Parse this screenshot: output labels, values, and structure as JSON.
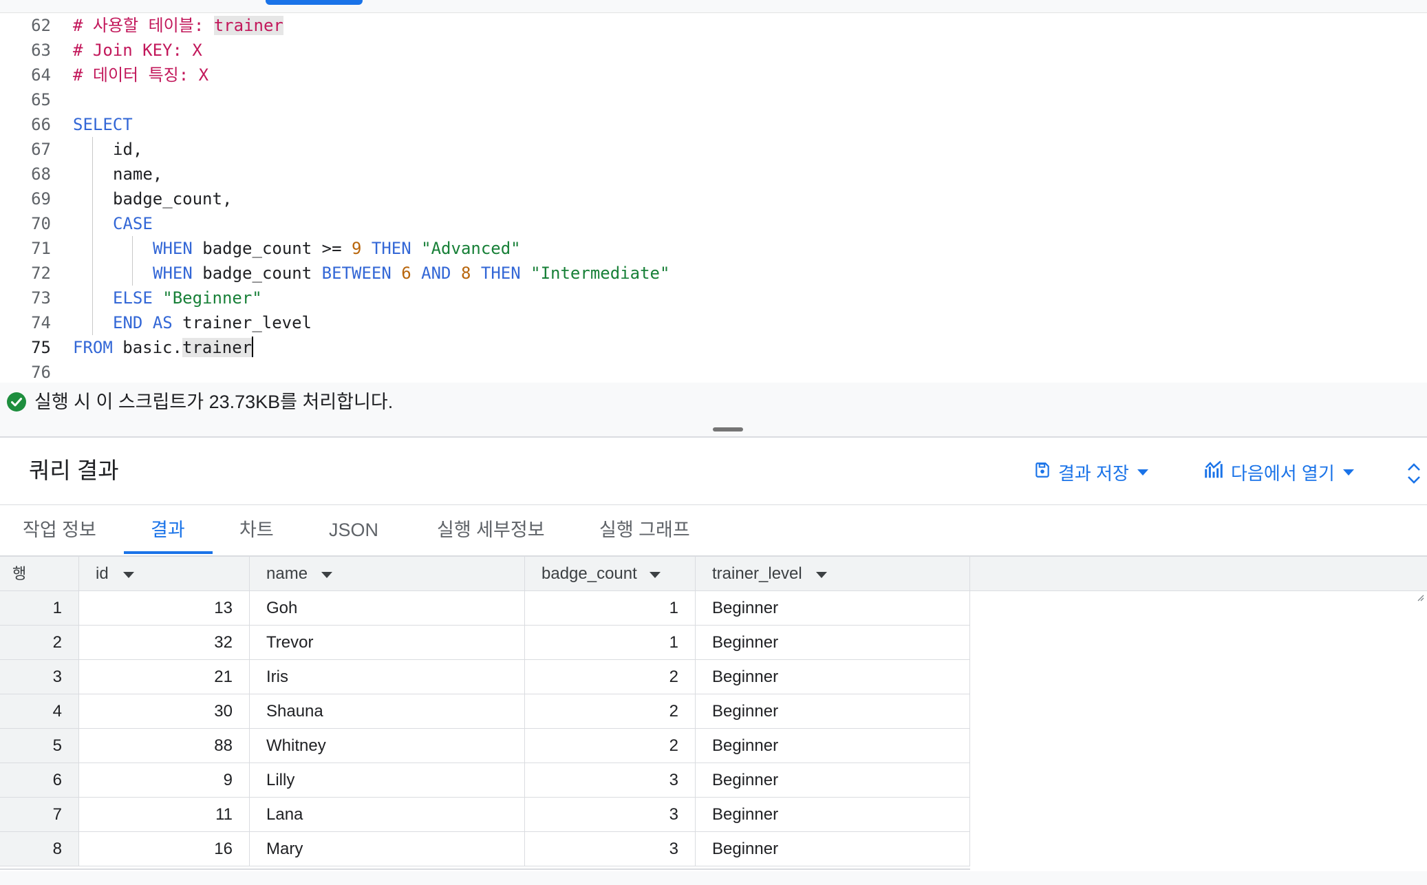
{
  "editor": {
    "lines": [
      {
        "num": "62",
        "tokens": [
          {
            "t": "# 사용할 테이블: ",
            "c": "comment"
          },
          {
            "t": "trainer",
            "c": "comment hl"
          }
        ]
      },
      {
        "num": "63",
        "tokens": [
          {
            "t": "# Join KEY: X",
            "c": "comment"
          }
        ]
      },
      {
        "num": "64",
        "tokens": [
          {
            "t": "# 데이터 특징: X",
            "c": "comment"
          }
        ]
      },
      {
        "num": "65",
        "tokens": []
      },
      {
        "num": "66",
        "tokens": [
          {
            "t": "SELECT",
            "c": "kw"
          }
        ]
      },
      {
        "num": "67",
        "indent": 1,
        "tokens": [
          {
            "t": "id,",
            "c": ""
          }
        ]
      },
      {
        "num": "68",
        "indent": 1,
        "tokens": [
          {
            "t": "name,",
            "c": ""
          }
        ]
      },
      {
        "num": "69",
        "indent": 1,
        "tokens": [
          {
            "t": "badge_count,",
            "c": ""
          }
        ]
      },
      {
        "num": "70",
        "indent": 1,
        "tokens": [
          {
            "t": "CASE",
            "c": "kw"
          }
        ]
      },
      {
        "num": "71",
        "indent": 2,
        "tokens": [
          {
            "t": "WHEN",
            "c": "kw"
          },
          {
            "t": " badge_count >= ",
            "c": ""
          },
          {
            "t": "9",
            "c": "num"
          },
          {
            "t": " ",
            "c": ""
          },
          {
            "t": "THEN",
            "c": "kw"
          },
          {
            "t": " ",
            "c": ""
          },
          {
            "t": "\"Advanced\"",
            "c": "str"
          }
        ]
      },
      {
        "num": "72",
        "indent": 2,
        "tokens": [
          {
            "t": "WHEN",
            "c": "kw"
          },
          {
            "t": " badge_count ",
            "c": ""
          },
          {
            "t": "BETWEEN",
            "c": "kw"
          },
          {
            "t": " ",
            "c": ""
          },
          {
            "t": "6",
            "c": "num"
          },
          {
            "t": " ",
            "c": ""
          },
          {
            "t": "AND",
            "c": "kw"
          },
          {
            "t": " ",
            "c": ""
          },
          {
            "t": "8",
            "c": "num"
          },
          {
            "t": " ",
            "c": ""
          },
          {
            "t": "THEN",
            "c": "kw"
          },
          {
            "t": " ",
            "c": ""
          },
          {
            "t": "\"Intermediate\"",
            "c": "str"
          }
        ]
      },
      {
        "num": "73",
        "indent": 1,
        "tokens": [
          {
            "t": "ELSE",
            "c": "kw"
          },
          {
            "t": " ",
            "c": ""
          },
          {
            "t": "\"Beginner\"",
            "c": "str"
          }
        ]
      },
      {
        "num": "74",
        "indent": 1,
        "tokens": [
          {
            "t": "END",
            "c": "kw"
          },
          {
            "t": " ",
            "c": ""
          },
          {
            "t": "AS",
            "c": "kw"
          },
          {
            "t": " trainer_level",
            "c": ""
          }
        ]
      },
      {
        "num": "75",
        "active": true,
        "tokens": [
          {
            "t": "FROM",
            "c": "kw"
          },
          {
            "t": " basic.",
            "c": ""
          },
          {
            "t": "trainer",
            "c": "hl"
          }
        ],
        "caret": true
      },
      {
        "num": "76",
        "tokens": []
      }
    ]
  },
  "status": {
    "icon": "check-circle-icon",
    "text": "실행 시 이 스크립트가 23.73KB를 처리합니다."
  },
  "results": {
    "title": "쿼리 결과",
    "save_label": "결과 저장",
    "open_label": "다음에서 열기",
    "tabs": [
      "작업 정보",
      "결과",
      "차트",
      "JSON",
      "실행 세부정보",
      "실행 그래프"
    ],
    "active_tab": 1,
    "columns": {
      "row": "행",
      "id": "id",
      "name": "name",
      "badge_count": "badge_count",
      "trainer_level": "trainer_level"
    },
    "rows": [
      {
        "row": "1",
        "id": "13",
        "name": "Goh",
        "badge_count": "1",
        "trainer_level": "Beginner"
      },
      {
        "row": "2",
        "id": "32",
        "name": "Trevor",
        "badge_count": "1",
        "trainer_level": "Beginner"
      },
      {
        "row": "3",
        "id": "21",
        "name": "Iris",
        "badge_count": "2",
        "trainer_level": "Beginner"
      },
      {
        "row": "4",
        "id": "30",
        "name": "Shauna",
        "badge_count": "2",
        "trainer_level": "Beginner"
      },
      {
        "row": "5",
        "id": "88",
        "name": "Whitney",
        "badge_count": "2",
        "trainer_level": "Beginner"
      },
      {
        "row": "6",
        "id": "9",
        "name": "Lilly",
        "badge_count": "3",
        "trainer_level": "Beginner"
      },
      {
        "row": "7",
        "id": "11",
        "name": "Lana",
        "badge_count": "3",
        "trainer_level": "Beginner"
      },
      {
        "row": "8",
        "id": "16",
        "name": "Mary",
        "badge_count": "3",
        "trainer_level": "Beginner"
      }
    ]
  },
  "colors": {
    "accent": "#1a73e8",
    "success": "#1e8e3e",
    "comment": "#c2185b",
    "keyword": "#3367d6",
    "number": "#b8650b",
    "string": "#188038"
  }
}
